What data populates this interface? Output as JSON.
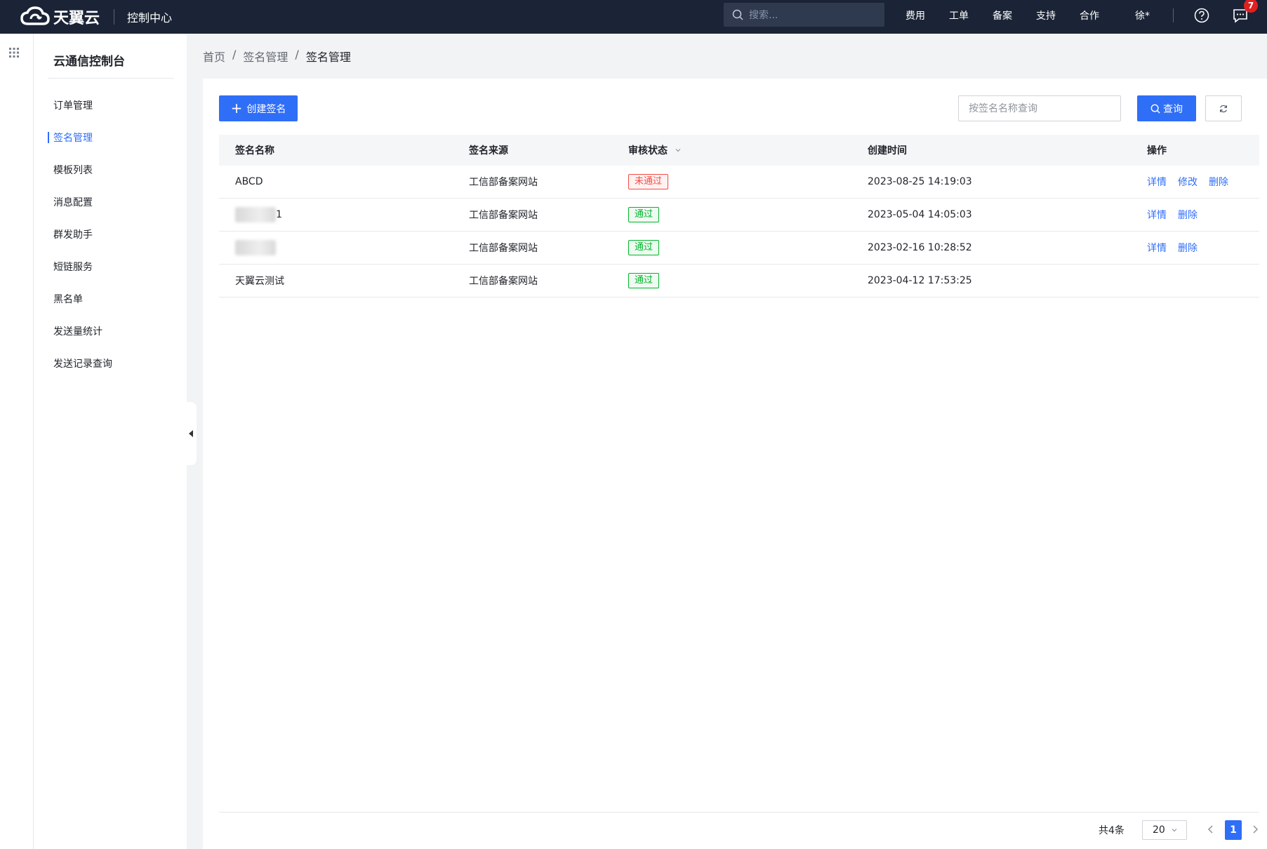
{
  "topbar": {
    "brand": "天翼云",
    "console_title": "控制中心",
    "search_placeholder": "搜索...",
    "nav": [
      "费用",
      "工单",
      "备案",
      "支持",
      "合作"
    ],
    "user": "徐*",
    "message_count": "7"
  },
  "sidebar": {
    "title": "云通信控制台",
    "items": [
      {
        "label": "订单管理"
      },
      {
        "label": "签名管理",
        "active": true
      },
      {
        "label": "模板列表"
      },
      {
        "label": "消息配置"
      },
      {
        "label": "群发助手"
      },
      {
        "label": "短链服务"
      },
      {
        "label": "黑名单"
      },
      {
        "label": "发送量统计"
      },
      {
        "label": "发送记录查询"
      }
    ]
  },
  "breadcrumb": [
    "首页",
    "签名管理",
    "签名管理"
  ],
  "toolbar": {
    "create_label": "创建签名",
    "search_placeholder": "按签名名称查询",
    "query_label": "查询"
  },
  "table": {
    "columns": [
      "签名名称",
      "签名来源",
      "审核状态",
      "创建时间",
      "操作"
    ],
    "rows": [
      {
        "name": "ABCD",
        "source": "工信部备案网站",
        "status": "未通过",
        "time": "2023-08-25 14:19:03",
        "ops": [
          "详情",
          "修改",
          "删除"
        ]
      },
      {
        "name": "1",
        "source": "工信部备案网站",
        "status": "通过",
        "time": "2023-05-04 14:05:03",
        "ops": [
          "详情",
          "删除"
        ]
      },
      {
        "name": "",
        "source": "工信部备案网站",
        "status": "通过",
        "time": "2023-02-16 10:28:52",
        "ops": [
          "详情",
          "删除"
        ]
      },
      {
        "name": "天翼云测试",
        "source": "工信部备案网站",
        "status": "通过",
        "time": "2023-04-12 17:53:25",
        "ops": []
      }
    ]
  },
  "pagination": {
    "total": "共4条",
    "page_size": "20",
    "current_page": "1"
  },
  "colors": {
    "accent": "#2f6ef7",
    "topbar": "#1b2436",
    "fail": "#f54a45",
    "pass": "#00b42a"
  }
}
